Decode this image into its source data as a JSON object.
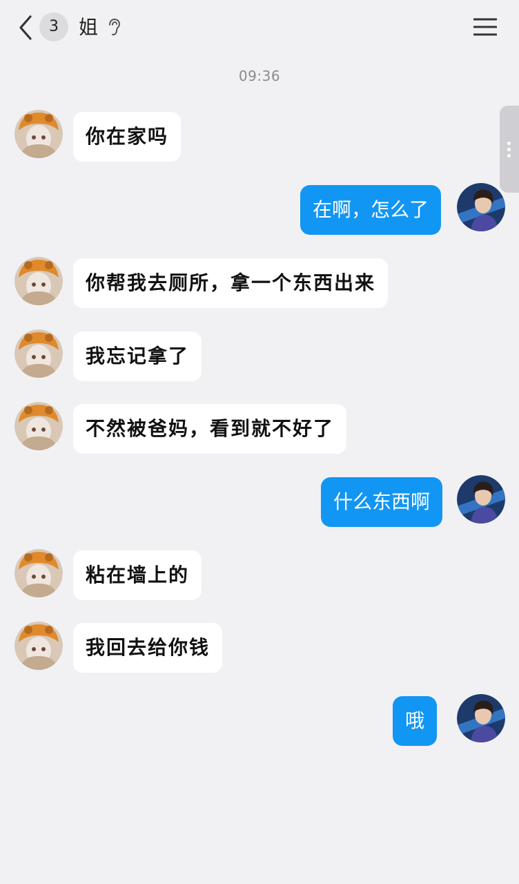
{
  "header": {
    "unread_count": "3",
    "contact_name": "姐"
  },
  "timestamp": "09:36",
  "colors": {
    "background": "#f1f1f3",
    "incoming_bubble": "#ffffff",
    "outgoing_bubble": "#1296f3"
  },
  "messages": [
    {
      "from": "contact",
      "text": "你在家吗"
    },
    {
      "from": "me",
      "text": "在啊，怎么了"
    },
    {
      "from": "contact",
      "text": "你帮我去厕所，拿一个东西出来"
    },
    {
      "from": "contact",
      "text": "我忘记拿了"
    },
    {
      "from": "contact",
      "text": "不然被爸妈，看到就不好了"
    },
    {
      "from": "me",
      "text": "什么东西啊"
    },
    {
      "from": "contact",
      "text": "粘在墙上的"
    },
    {
      "from": "contact",
      "text": "我回去给你钱"
    },
    {
      "from": "me",
      "text": "哦"
    }
  ]
}
